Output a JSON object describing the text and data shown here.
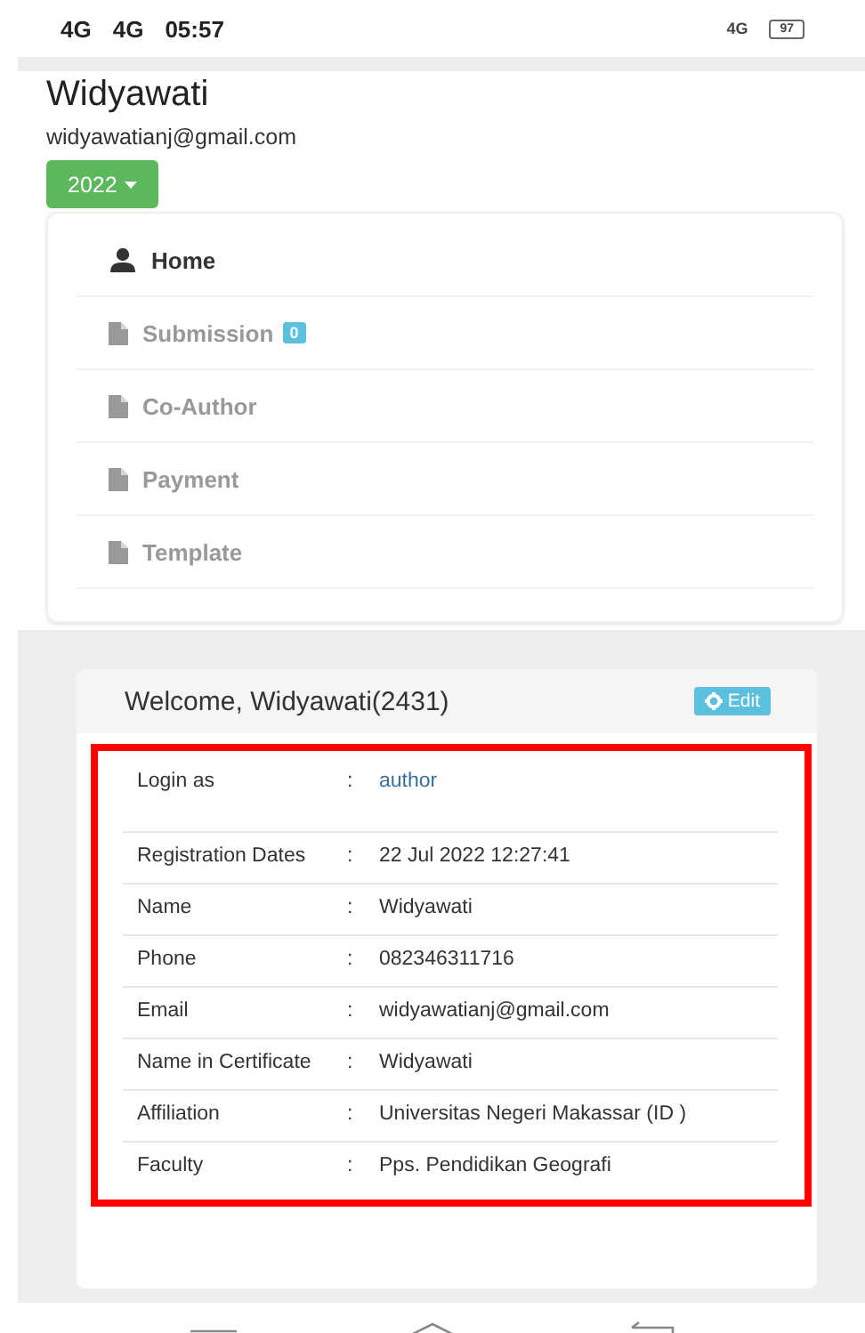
{
  "status_bar": {
    "signals": [
      "4G",
      "4G"
    ],
    "time": "05:57",
    "network": "4G",
    "battery": "97"
  },
  "profile": {
    "name": "Widyawati",
    "email": "widyawatianj@gmail.com",
    "year_button": "2022"
  },
  "menu": [
    {
      "label": "Home",
      "kind": "user",
      "selected": true
    },
    {
      "label": "Submission",
      "kind": "file",
      "selected": false,
      "badge": "0"
    },
    {
      "label": "Co-Author",
      "kind": "file",
      "selected": false
    },
    {
      "label": "Payment",
      "kind": "file",
      "selected": false
    },
    {
      "label": "Template",
      "kind": "file",
      "selected": false
    }
  ],
  "panel": {
    "title": "Welcome, Widyawati(2431)",
    "edit_button": "Edit",
    "highlighted": true,
    "rows": [
      {
        "label": "Login as",
        "separator": ":",
        "value": "author",
        "kind": "link"
      },
      {
        "label": "Registration Dates",
        "separator": ":",
        "value": "22 Jul 2022 12:27:41",
        "kind": "text"
      },
      {
        "label": "Name",
        "separator": ":",
        "value": "Widyawati",
        "kind": "text"
      },
      {
        "label": "Phone",
        "separator": ":",
        "value": "082346311716",
        "kind": "text"
      },
      {
        "label": "Email",
        "separator": ":",
        "value": "widyawatianj@gmail.com",
        "kind": "text"
      },
      {
        "label": "Name in Certificate",
        "separator": ":",
        "value": "Widyawati",
        "kind": "text"
      },
      {
        "label": "Affiliation",
        "separator": ":",
        "value": "Universitas Negeri Makassar (ID )",
        "kind": "text"
      },
      {
        "label": "Faculty",
        "separator": ":",
        "value": "Pps. Pendidikan Geografi",
        "kind": "text"
      }
    ]
  }
}
